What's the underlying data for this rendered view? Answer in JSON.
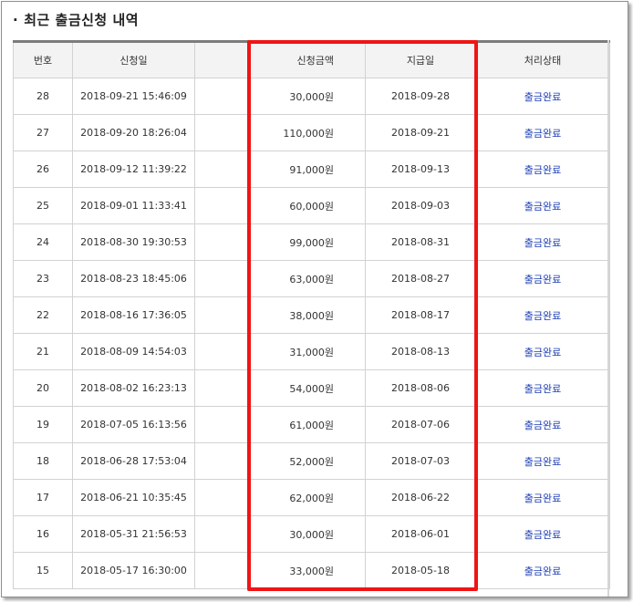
{
  "section": {
    "bullet": "·",
    "title": "최근 출금신청 내역"
  },
  "table": {
    "headers": {
      "no": "번호",
      "request_date": "신청일",
      "blank": "",
      "amount": "신청금액",
      "pay_date": "지급일",
      "status": "처리상태"
    },
    "rows": [
      {
        "no": "28",
        "request_date": "2018-09-21 15:46:09",
        "amount": "30,000원",
        "pay_date": "2018-09-28",
        "status": "출금완료"
      },
      {
        "no": "27",
        "request_date": "2018-09-20 18:26:04",
        "amount": "110,000원",
        "pay_date": "2018-09-21",
        "status": "출금완료"
      },
      {
        "no": "26",
        "request_date": "2018-09-12 11:39:22",
        "amount": "91,000원",
        "pay_date": "2018-09-13",
        "status": "출금완료"
      },
      {
        "no": "25",
        "request_date": "2018-09-01 11:33:41",
        "amount": "60,000원",
        "pay_date": "2018-09-03",
        "status": "출금완료"
      },
      {
        "no": "24",
        "request_date": "2018-08-30 19:30:53",
        "amount": "99,000원",
        "pay_date": "2018-08-31",
        "status": "출금완료"
      },
      {
        "no": "23",
        "request_date": "2018-08-23 18:45:06",
        "amount": "63,000원",
        "pay_date": "2018-08-27",
        "status": "출금완료"
      },
      {
        "no": "22",
        "request_date": "2018-08-16 17:36:05",
        "amount": "38,000원",
        "pay_date": "2018-08-17",
        "status": "출금완료"
      },
      {
        "no": "21",
        "request_date": "2018-08-09 14:54:03",
        "amount": "31,000원",
        "pay_date": "2018-08-13",
        "status": "출금완료"
      },
      {
        "no": "20",
        "request_date": "2018-08-02 16:23:13",
        "amount": "54,000원",
        "pay_date": "2018-08-06",
        "status": "출금완료"
      },
      {
        "no": "19",
        "request_date": "2018-07-05 16:13:56",
        "amount": "61,000원",
        "pay_date": "2018-07-06",
        "status": "출금완료"
      },
      {
        "no": "18",
        "request_date": "2018-06-28 17:53:04",
        "amount": "52,000원",
        "pay_date": "2018-07-03",
        "status": "출금완료"
      },
      {
        "no": "17",
        "request_date": "2018-06-21 10:35:45",
        "amount": "62,000원",
        "pay_date": "2018-06-22",
        "status": "출금완료"
      },
      {
        "no": "16",
        "request_date": "2018-05-31 21:56:53",
        "amount": "30,000원",
        "pay_date": "2018-06-01",
        "status": "출금완료"
      },
      {
        "no": "15",
        "request_date": "2018-05-17 16:30:00",
        "amount": "33,000원",
        "pay_date": "2018-05-18",
        "status": "출금완료"
      }
    ]
  },
  "colors": {
    "status_link": "#1d3fb4",
    "highlight_box": "#f01414",
    "header_bg": "#f3f3f3"
  }
}
